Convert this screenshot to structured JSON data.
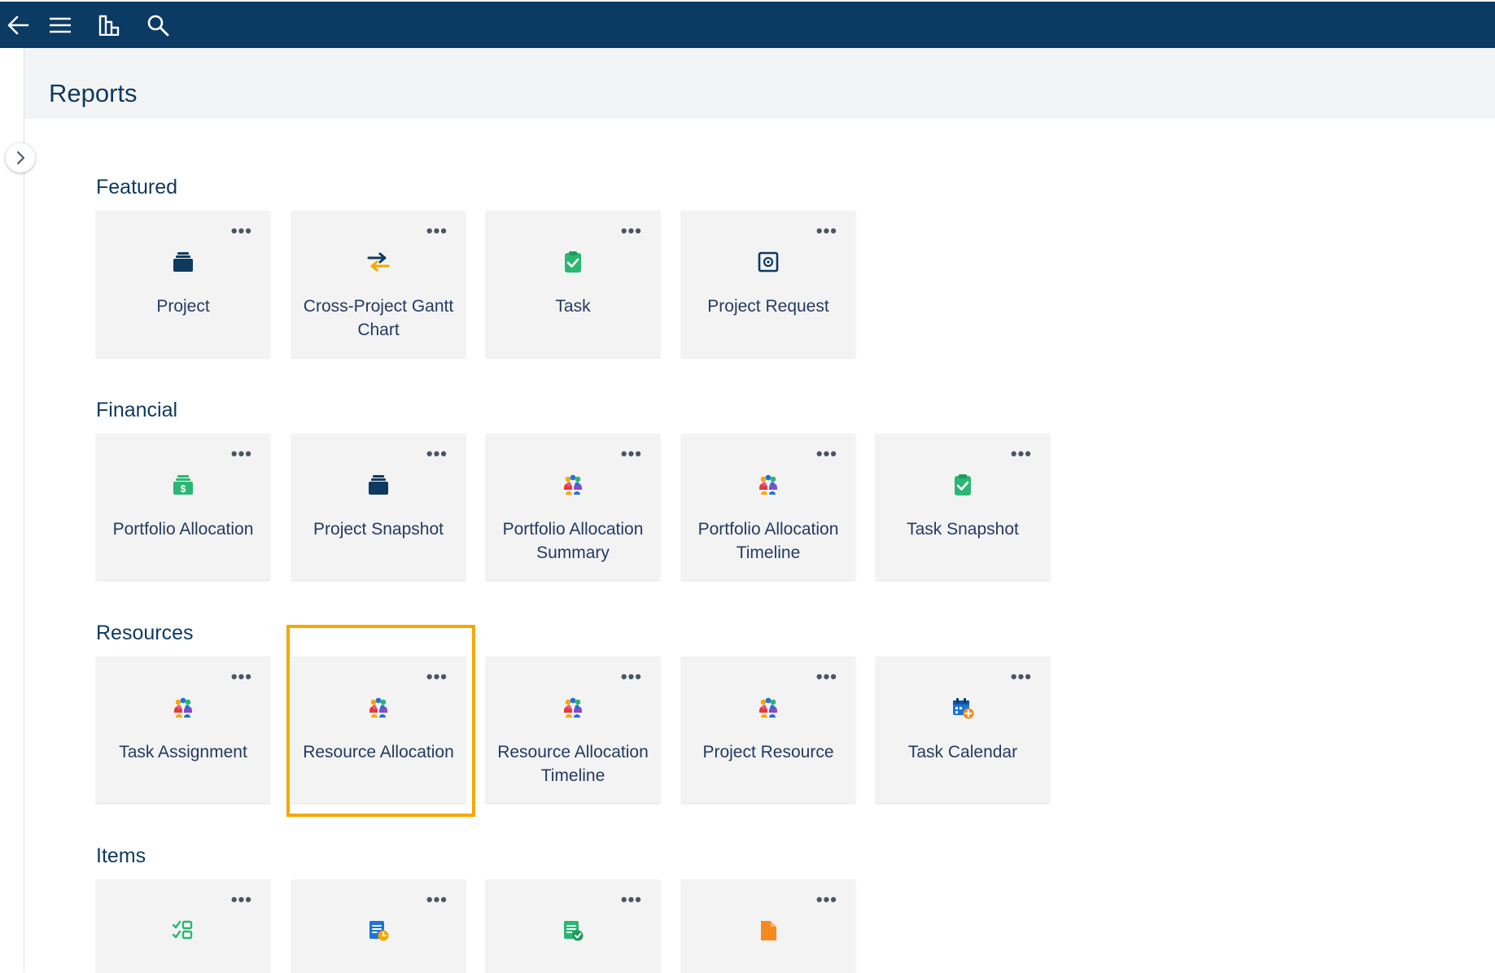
{
  "topbar": {
    "icons": [
      "back-arrow-icon",
      "menu-icon",
      "reports-chart-icon",
      "search-icon"
    ],
    "color": "#0b3a63"
  },
  "page": {
    "title": "Reports"
  },
  "sections": [
    {
      "title": "Featured",
      "tiles": [
        {
          "label": "Project",
          "icon": "briefcase-icon"
        },
        {
          "label": "Cross-Project Gantt Chart",
          "icon": "swap-arrows-icon"
        },
        {
          "label": "Task",
          "icon": "task-clipboard-icon"
        },
        {
          "label": "Project Request",
          "icon": "safe-icon"
        }
      ]
    },
    {
      "title": "Financial",
      "tiles": [
        {
          "label": "Portfolio Allocation",
          "icon": "money-briefcase-icon"
        },
        {
          "label": "Project Snapshot",
          "icon": "briefcase-icon"
        },
        {
          "label": "Portfolio Allocation Summary",
          "icon": "people-group-icon"
        },
        {
          "label": "Portfolio Allocation Timeline",
          "icon": "people-group-icon"
        },
        {
          "label": "Task Snapshot",
          "icon": "task-clipboard-icon"
        }
      ]
    },
    {
      "title": "Resources",
      "tiles": [
        {
          "label": "Task Assignment",
          "icon": "people-group-icon"
        },
        {
          "label": "Resource Allocation",
          "icon": "people-group-icon"
        },
        {
          "label": "Resource Allocation Timeline",
          "icon": "people-group-icon"
        },
        {
          "label": "Project Resource",
          "icon": "people-group-icon"
        },
        {
          "label": "Task Calendar",
          "icon": "calendar-add-icon"
        }
      ]
    },
    {
      "title": "Items",
      "tiles": [
        {
          "label": "",
          "icon": "checklist-icon"
        },
        {
          "label": "",
          "icon": "document-clock-icon"
        },
        {
          "label": "",
          "icon": "document-check-icon"
        },
        {
          "label": "",
          "icon": "file-icon"
        }
      ]
    }
  ],
  "more_glyph": "•••",
  "highlight_color": "#f5a800"
}
